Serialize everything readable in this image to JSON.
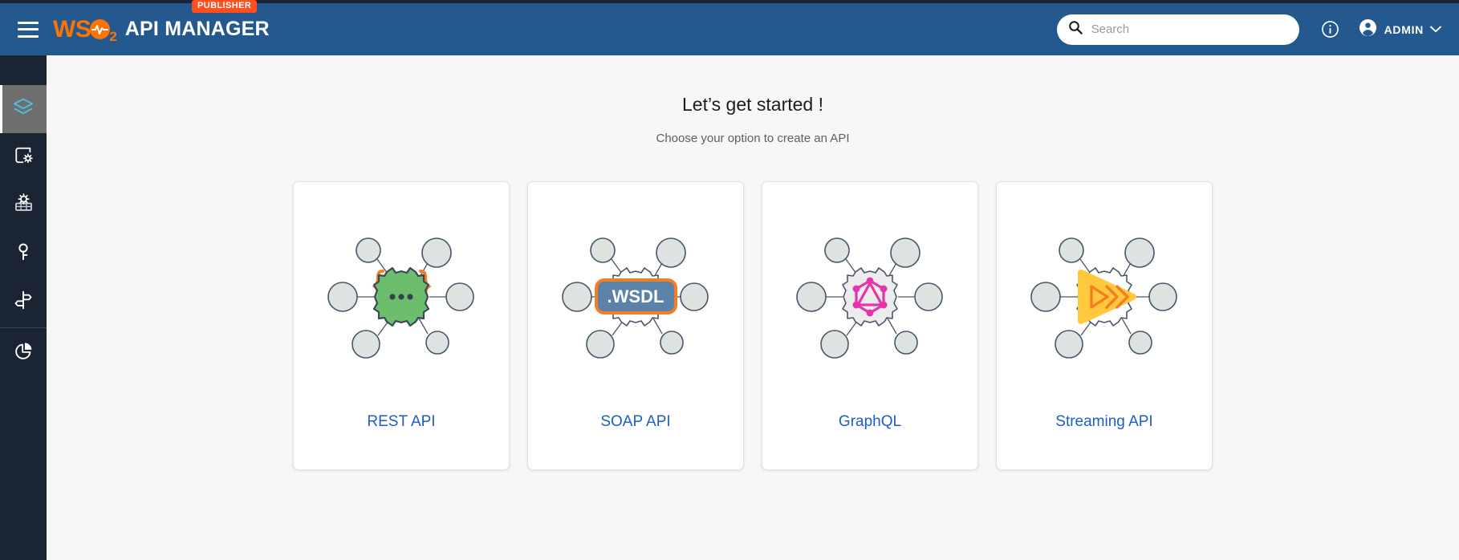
{
  "header": {
    "menu_icon": "hamburger-menu-icon",
    "brand": {
      "logo_text": "WS",
      "logo_subscript": "2",
      "title": "API MANAGER",
      "badge": "PUBLISHER"
    },
    "search": {
      "placeholder": "Search",
      "value": "",
      "icon": "search-icon"
    },
    "help_icon": "info-circle-icon",
    "user": {
      "avatar_icon": "account-circle-icon",
      "name": "ADMIN",
      "chevron_icon": "chevron-down-icon"
    },
    "colors": {
      "background": "#24598f",
      "brand_orange": "#ff7300",
      "badge_orange": "#ff4f1f"
    }
  },
  "sidebar": {
    "items": [
      {
        "name": "apis",
        "icon": "layers-icon",
        "active": true
      },
      {
        "name": "api-products",
        "icon": "api-product-icon",
        "active": false
      },
      {
        "name": "service-catalog",
        "icon": "service-catalog-icon",
        "active": false
      },
      {
        "name": "key-managers",
        "icon": "key-icon",
        "active": false
      },
      {
        "name": "policies",
        "icon": "signpost-icon",
        "active": false
      },
      {
        "name": "analytics",
        "icon": "pie-chart-icon",
        "active": false
      }
    ],
    "colors": {
      "background": "#1b2433",
      "active_background": "#6e6e6e",
      "active_icon": "#4dbdd8"
    }
  },
  "main": {
    "title": "Let’s get started !",
    "subtitle": "Choose your option to create an API",
    "cards": [
      {
        "label": "REST API",
        "art": "rest-api-illustration",
        "accent": "#6cbd6c",
        "brace_color": "#f57c20"
      },
      {
        "label": "SOAP API",
        "art": "soap-api-illustration",
        "badge_text": ".WSDL",
        "accent": "#5b82a8",
        "outline_color": "#f57c20"
      },
      {
        "label": "GraphQL",
        "art": "graphql-illustration",
        "accent": "#e535ab"
      },
      {
        "label": "Streaming API",
        "art": "streaming-api-illustration",
        "accent": "#ffc83d",
        "arrow_color": "#f57c20"
      }
    ],
    "label_color": "#1a5ec9",
    "background": "#f7f7f7"
  }
}
